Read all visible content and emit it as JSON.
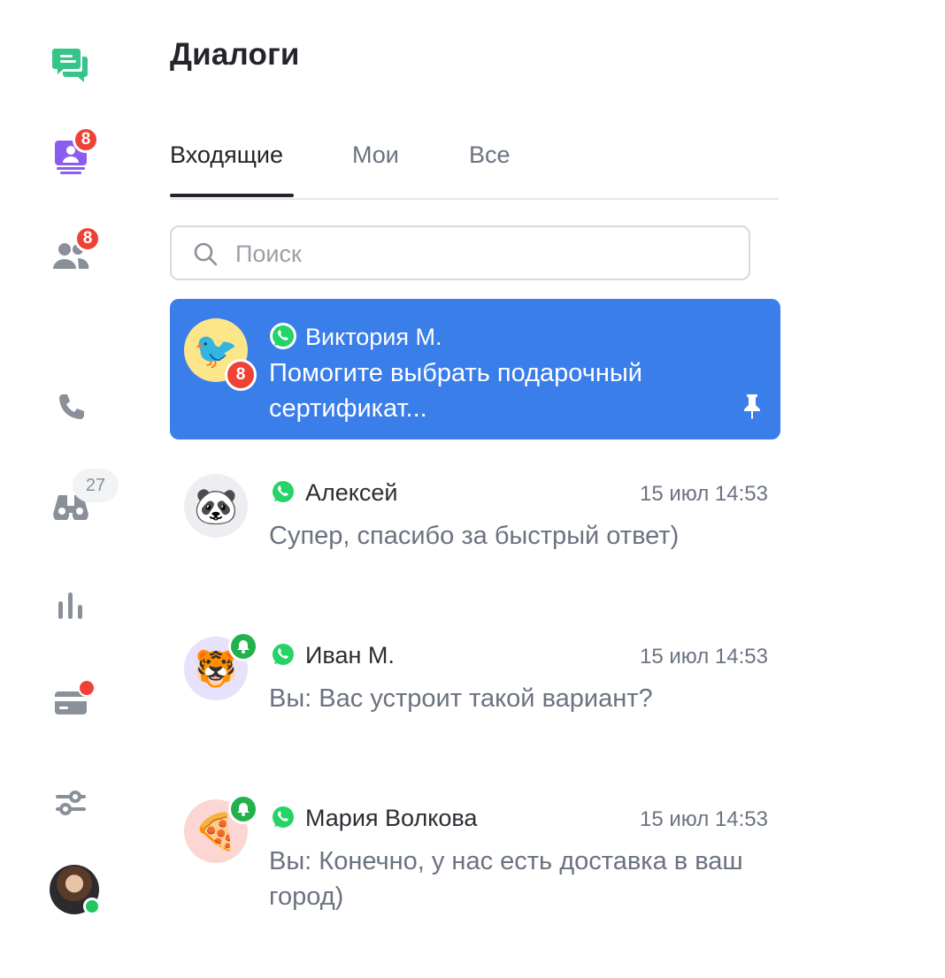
{
  "sidebar": {
    "items": [
      {
        "id": "dialogs",
        "icon": "chat-bubbles-icon",
        "color": "#35c48a"
      },
      {
        "id": "requests",
        "icon": "inbox-person-icon",
        "color": "#8a5cf0",
        "badge": "8"
      },
      {
        "id": "contacts",
        "icon": "people-icon",
        "color": "#8a9099",
        "badge": "8"
      },
      {
        "id": "calls",
        "icon": "phone-icon",
        "color": "#8a9099"
      },
      {
        "id": "watching",
        "icon": "binoculars-icon",
        "color": "#8a9099",
        "count": "27"
      },
      {
        "id": "analytics",
        "icon": "bar-chart-icon",
        "color": "#8a9099"
      },
      {
        "id": "billing",
        "icon": "credit-card-icon",
        "color": "#8a9099",
        "dot": "red"
      },
      {
        "id": "settings",
        "icon": "sliders-icon",
        "color": "#8a9099"
      }
    ],
    "user": {
      "status": "online"
    }
  },
  "header": {
    "title": "Диалоги"
  },
  "tabs": [
    {
      "label": "Входящие",
      "active": true
    },
    {
      "label": "Мои",
      "active": false
    },
    {
      "label": "Все",
      "active": false
    }
  ],
  "search": {
    "placeholder": "Поиск",
    "value": ""
  },
  "dialogs": [
    {
      "name": "Виктория М.",
      "preview": "Помогите выбрать подарочный сертификат...",
      "time": "",
      "unread": "8",
      "avatar_emoji": "🐦",
      "avatar_bg": "#fde58a",
      "channel": "whatsapp-icon",
      "pinned": true,
      "active": true
    },
    {
      "name": "Алексей",
      "preview": "Супер, спасибо за быстрый ответ)",
      "time": "15 июл 14:53",
      "avatar_emoji": "🐼",
      "avatar_bg": "#eceef1",
      "channel": "whatsapp-icon"
    },
    {
      "name": "Иван М.",
      "preview": "Вы: Вас устроит такой вариант?",
      "time": "15 июл 14:53",
      "avatar_emoji": "🐯",
      "avatar_bg": "#e7e1fb",
      "channel": "whatsapp-icon",
      "reminder": true
    },
    {
      "name": "Мария Волкова",
      "preview": "Вы: Конечно, у нас есть доставка в ваш город)",
      "time": "15 июл 14:53",
      "avatar_emoji": "🍕",
      "avatar_bg": "#fcd6d3",
      "channel": "whatsapp-icon",
      "reminder": true
    }
  ],
  "colors": {
    "accent": "#3a7ee9",
    "badge": "#ef4136",
    "online": "#22c55e",
    "whatsapp": "#25d366"
  }
}
